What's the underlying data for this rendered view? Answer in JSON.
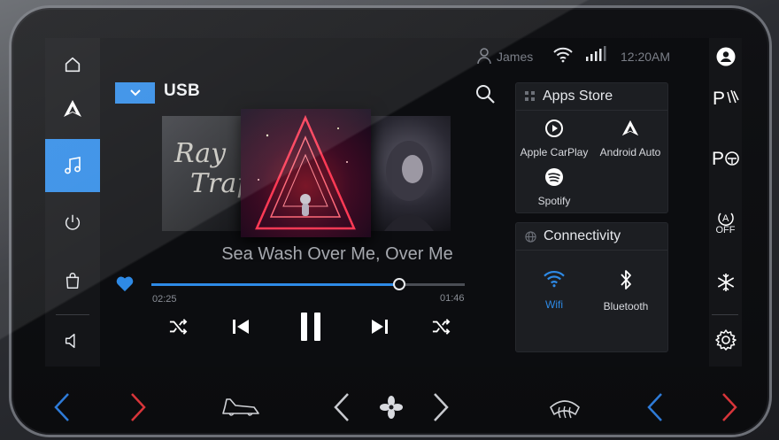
{
  "status": {
    "user_name": "James",
    "time": "12:20AM"
  },
  "source": {
    "label": "USB"
  },
  "player": {
    "track_title": "Sea Wash Over Me, Over Me",
    "elapsed": "02:25",
    "duration": "01:46",
    "progress_fraction": 0.79,
    "liked": true,
    "left_cover_text_line1": "Ray",
    "left_cover_text_line2": "Trap"
  },
  "apps_store": {
    "title": "Apps Store",
    "apps": [
      {
        "label": "Apple CarPlay",
        "icon": "carplay-icon"
      },
      {
        "label": "Android Auto",
        "icon": "android-auto-icon"
      },
      {
        "label": "Spotify",
        "icon": "spotify-icon"
      }
    ]
  },
  "connectivity": {
    "title": "Connectivity",
    "items": [
      {
        "label": "Wifi",
        "icon": "wifi-icon",
        "active": true
      },
      {
        "label": "Bluetooth",
        "icon": "bluetooth-icon",
        "active": false
      }
    ]
  },
  "right_nav": {
    "ac_off_label": "OFF",
    "ac_label": "A"
  },
  "colors": {
    "accent": "#2e8ae6",
    "climate_cool": "#2e7bd8",
    "climate_warm": "#d8353a"
  }
}
